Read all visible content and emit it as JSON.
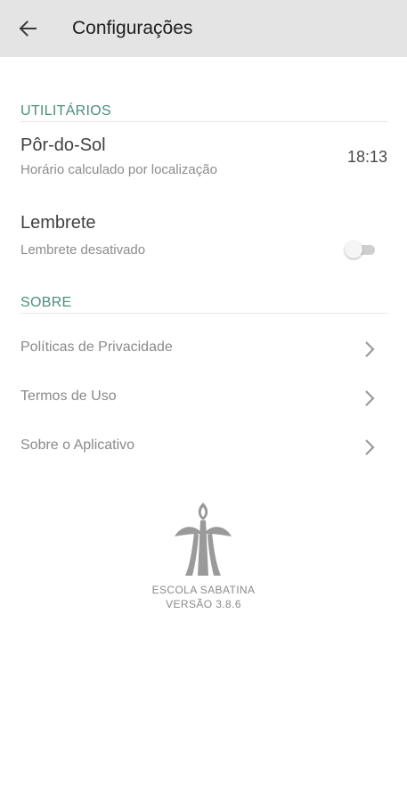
{
  "header": {
    "title": "Configurações",
    "back_icon": "arrow-left-icon"
  },
  "utilities": {
    "section_label": "UTILITÁRIOS",
    "sunset": {
      "title": "Pôr-do-Sol",
      "subtitle": "Horário calculado por localização",
      "time": "18:13"
    },
    "reminder": {
      "title": "Lembrete",
      "subtitle": "Lembrete desativado",
      "enabled": false
    }
  },
  "about": {
    "section_label": "SOBRE",
    "links": [
      {
        "label": "Políticas de Privacidade",
        "icon": "chevron-right-icon"
      },
      {
        "label": "Termos de Uso",
        "icon": "chevron-right-icon"
      },
      {
        "label": "Sobre o Aplicativo",
        "icon": "chevron-right-icon"
      }
    ]
  },
  "footer": {
    "app_name": "ESCOLA SABATINA",
    "version": "VERSÃO 3.8.6"
  },
  "colors": {
    "accent": "#4c8f7d",
    "appbar": "#e4e4e4"
  }
}
